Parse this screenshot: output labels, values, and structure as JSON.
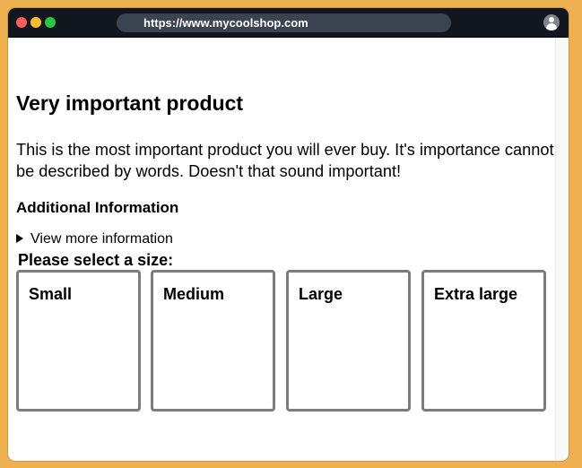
{
  "browser": {
    "url": "https://www.mycoolshop.com"
  },
  "product": {
    "title": "Very important product",
    "description": "This is the most important product you will ever buy. It's importance cannot be described by words. Doesn't that sound important!",
    "additional_heading": "Additional Information",
    "details_summary": "View more information"
  },
  "size_selector": {
    "label": "Please select a size:",
    "options": [
      {
        "label": "Small"
      },
      {
        "label": "Medium"
      },
      {
        "label": "Large"
      },
      {
        "label": "Extra large"
      }
    ]
  },
  "icons": {
    "account": "account-icon",
    "disclosure": "disclosure-triangle-icon"
  },
  "colors": {
    "page_background": "#efb14f",
    "titlebar": "#11161f",
    "urlbar": "#3b4350",
    "card_border": "#7c7c7c",
    "close": "#ff5f57",
    "minimize": "#febc2e",
    "maximize": "#28c840"
  }
}
